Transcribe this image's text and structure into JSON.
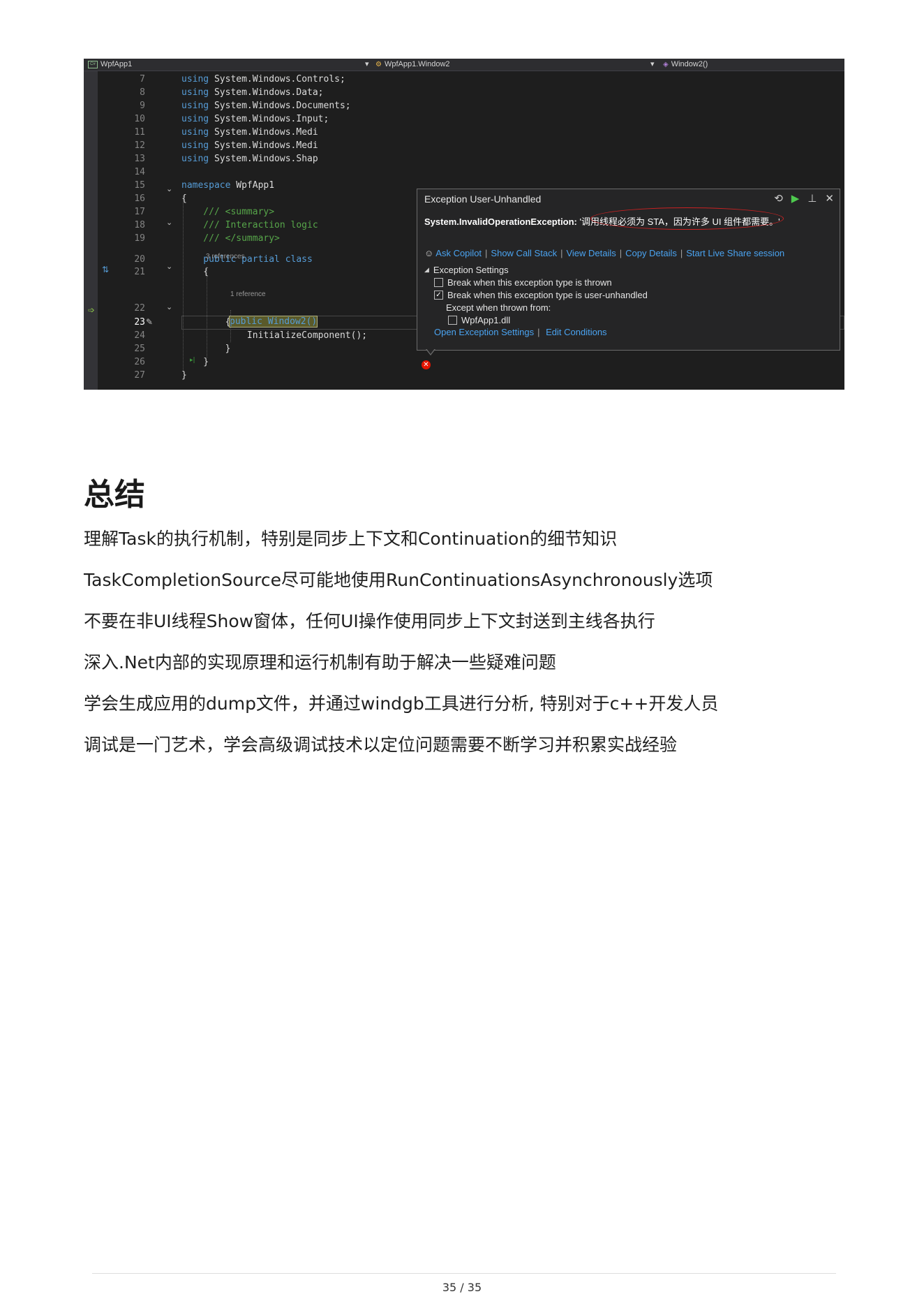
{
  "ide": {
    "nav": {
      "project": "WpfApp1",
      "class_path": "WpfApp1.Window2",
      "member": "Window2()"
    },
    "code_lines": [
      {
        "num": "7",
        "kw": "using",
        "rest": " System.Windows.Controls;"
      },
      {
        "num": "8",
        "kw": "using",
        "rest": " System.Windows.Data;"
      },
      {
        "num": "9",
        "kw": "using",
        "rest": " System.Windows.Documents;"
      },
      {
        "num": "10",
        "kw": "using",
        "rest": " System.Windows.Input;"
      },
      {
        "num": "11",
        "kw": "using",
        "rest": " System.Windows.Medi"
      },
      {
        "num": "12",
        "kw": "using",
        "rest": " System.Windows.Medi"
      },
      {
        "num": "13",
        "kw": "using",
        "rest": " System.Windows.Shap"
      },
      {
        "num": "14",
        "kw": "",
        "rest": ""
      },
      {
        "num": "15",
        "kw": "namespace",
        "rest": " WpfApp1"
      },
      {
        "num": "16",
        "kw": "",
        "rest": "{"
      },
      {
        "num": "17",
        "cm": "    /// <summary>"
      },
      {
        "num": "18",
        "cm": "    /// Interaction logic"
      },
      {
        "num": "19",
        "cm": "    /// </summary>"
      },
      {
        "num": "20",
        "kw": "    public partial class",
        "rest": ""
      },
      {
        "num": "21",
        "kw": "",
        "rest": "    {"
      },
      {
        "num": "22",
        "kw": "",
        "rest": ""
      },
      {
        "num": "23",
        "kw": "",
        "rest": "        {"
      },
      {
        "num": "24",
        "kw": "",
        "rest": "            InitializeComponent();"
      },
      {
        "num": "25",
        "kw": "",
        "rest": "        }"
      },
      {
        "num": "26",
        "kw": "",
        "rest": "    }"
      },
      {
        "num": "27",
        "kw": "",
        "rest": "}"
      }
    ],
    "ctor_text": "public Window2()",
    "refs_3": "3 references",
    "refs_1": "1 reference",
    "popup": {
      "title": "Exception User-Unhandled",
      "exception_type": "System.InvalidOperationException:",
      "exception_message": " '调用线程必须为 STA，因为许多 UI 组件都需要。'",
      "links": [
        "Ask Copilot",
        "Show Call Stack",
        "View Details",
        "Copy Details",
        "Start Live Share session"
      ],
      "settings_header": "Exception Settings",
      "opt_thrown": "Break when this exception type is thrown",
      "opt_unhandled": "Break when this exception type is user-unhandled",
      "except_from": "Except when thrown from:",
      "module": "WpfApp1.dll",
      "bottom_links": [
        "Open Exception Settings",
        "Edit Conditions"
      ]
    }
  },
  "doc": {
    "heading": "总结",
    "paragraphs": [
      "理解Task的执行机制，特别是同步上下文和Continuation的细节知识",
      "TaskCompletionSource尽可能地使用RunContinuationsAsynchronously选项",
      "不要在非UI线程Show窗体，任何UI操作使用同步上下文封送到主线各执行",
      "深入.Net内部的实现原理和运行机制有助于解决一些疑难问题",
      "学会生成应用的dump文件，并通过windgb工具进行分析, 特别对于c++开发人员",
      "调试是一门艺术，学会高级调试技术以定位问题需要不断学习并积累实战经验"
    ],
    "page_number": "35 / 35"
  }
}
